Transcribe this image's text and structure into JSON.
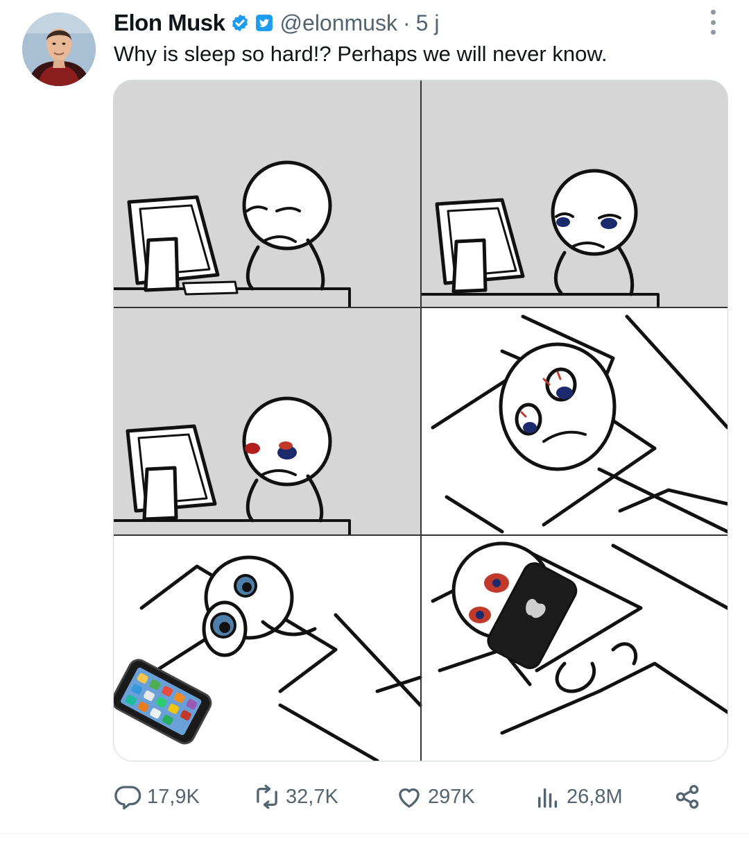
{
  "post": {
    "author_name": "Elon Musk",
    "handle": "@elonmusk",
    "separator": "·",
    "time": "5 j",
    "text": "Why is sleep so hard!? Perhaps we will never know."
  },
  "metrics": {
    "replies": "17,9K",
    "reposts": "32,7K",
    "likes": "297K",
    "views": "26,8M"
  },
  "colors": {
    "verified": "#1d9bf0",
    "secondary_text": "#536471",
    "panel_gray": "#d6d6d6"
  },
  "icons": [
    "verified-badge-icon",
    "twitter-bird-badge-icon",
    "more-options-icon",
    "reply-icon",
    "repost-icon",
    "like-icon",
    "views-icon",
    "share-icon"
  ]
}
